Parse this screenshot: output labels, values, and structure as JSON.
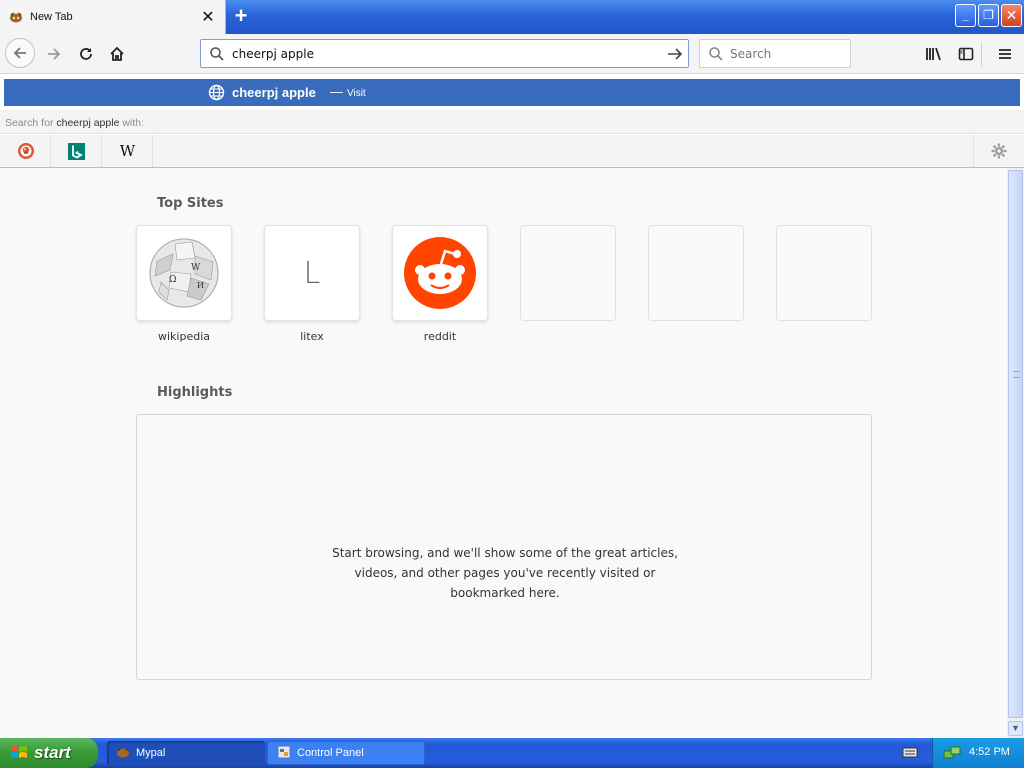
{
  "browser": {
    "tab": {
      "title": "New Tab",
      "close_glyph": "✕",
      "favicon": "mypal-icon"
    },
    "new_tab_glyph": "+",
    "window_buttons": {
      "minimize": "_",
      "maximize": "❐",
      "close": "✕"
    },
    "urlbar": {
      "value": "cheerpj apple",
      "go_icon": "arrow-right-icon"
    },
    "searchbar": {
      "placeholder": "Search"
    }
  },
  "autocomplete": {
    "main_text": "cheerpj apple",
    "separator": "—",
    "action": "Visit",
    "search_with_prefix": "Search for ",
    "search_with_term": "cheerpj apple",
    "search_with_suffix": " with:",
    "engines": [
      {
        "name": "DuckDuckGo",
        "icon": "duckduckgo-icon"
      },
      {
        "name": "Bing",
        "icon": "bing-icon"
      },
      {
        "name": "Wikipedia",
        "icon": "wikipedia-icon",
        "glyph": "W"
      }
    ]
  },
  "newtab": {
    "top_sites_title": "Top Sites",
    "top_sites": [
      {
        "label": "wikipedia",
        "icon": "wikipedia-globe-icon"
      },
      {
        "label": "litex",
        "letter": "L"
      },
      {
        "label": "reddit",
        "icon": "reddit-icon"
      },
      {
        "label": ""
      },
      {
        "label": ""
      },
      {
        "label": ""
      }
    ],
    "highlights_title": "Highlights",
    "highlights_message": "Start browsing, and we'll show some of the great articles, videos, and other pages you've recently visited or bookmarked here."
  },
  "taskbar": {
    "start_label": "start",
    "tasks": [
      {
        "label": "Mypal",
        "active": true
      },
      {
        "label": "Control Panel",
        "active": false
      }
    ],
    "clock": "4:52 PM"
  },
  "colors": {
    "accent": "#3a6cbe",
    "reddit": "#ff4500",
    "taskbar": "#245ddb",
    "start": "#3a9b3a"
  }
}
